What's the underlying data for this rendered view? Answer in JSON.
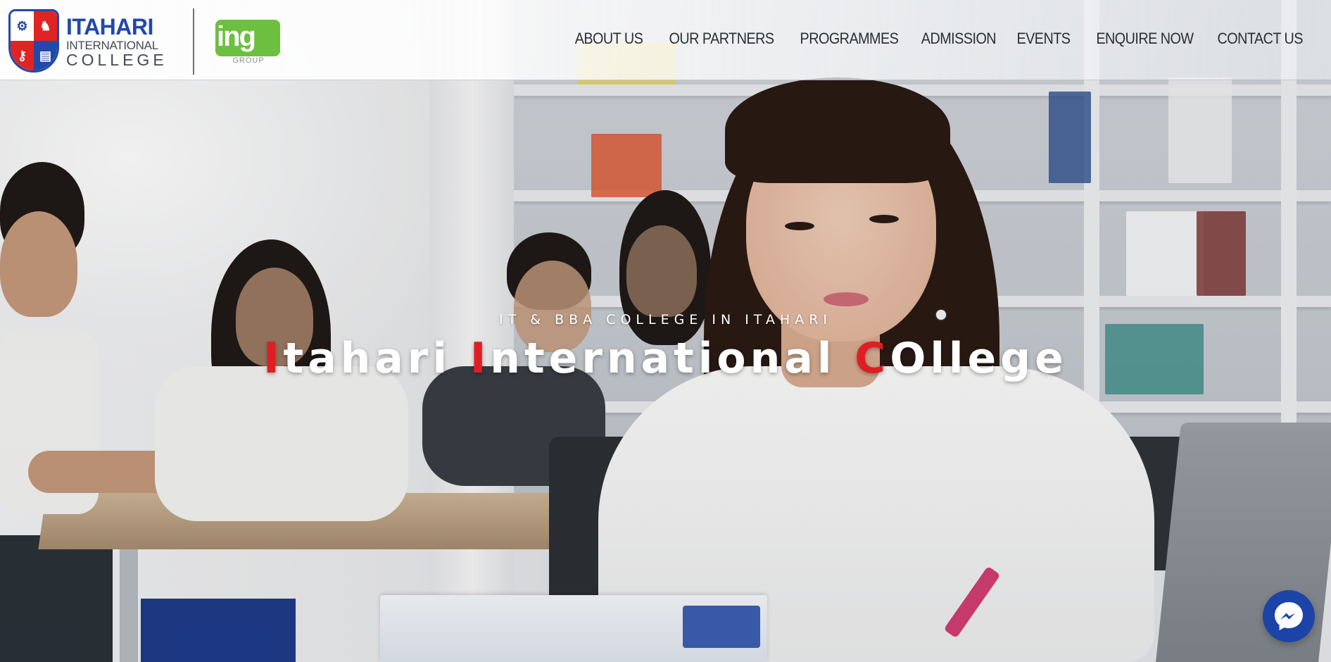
{
  "logo": {
    "line1": "ITAHARI",
    "line2": "INTERNATIONAL",
    "line3": "COLLEGE",
    "partner_mark": "ing",
    "partner_sub": "GROUP"
  },
  "nav": {
    "items": [
      {
        "label": "ABOUT US"
      },
      {
        "label": "OUR PARTNERS"
      },
      {
        "label": "PROGRAMMES"
      },
      {
        "label": "ADMISSION"
      },
      {
        "label": "EVENTS"
      },
      {
        "label": "ENQUIRE NOW"
      },
      {
        "label": "CONTACT US"
      }
    ]
  },
  "hero": {
    "eyebrow": "IT & BBA COLLEGE IN ITAHARI",
    "title_parts": [
      {
        "text": "I",
        "accent": true
      },
      {
        "text": "tahari ",
        "accent": false
      },
      {
        "text": "I",
        "accent": true
      },
      {
        "text": "nternational ",
        "accent": false
      },
      {
        "text": "C",
        "accent": true
      },
      {
        "text": "Ollege",
        "accent": false
      }
    ]
  },
  "colors": {
    "brand_blue": "#2248a8",
    "brand_red": "#e11d24",
    "ing_green": "#6cbf3f",
    "messenger_blue": "#1c43a8"
  },
  "icons": {
    "messenger": "messenger-icon"
  }
}
